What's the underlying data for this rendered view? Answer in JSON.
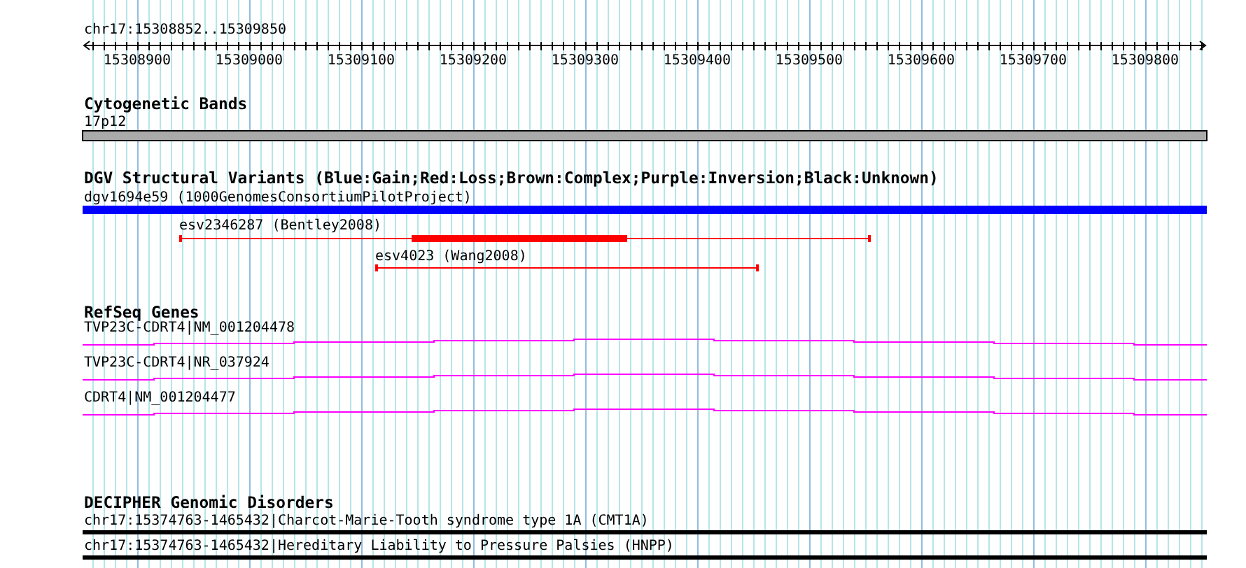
{
  "ruler": {
    "label": "chr17:15308852..15309850",
    "ticks": [
      "15308900",
      "15309000",
      "15309100",
      "15309200",
      "15309300",
      "15309400",
      "15309500",
      "15309600",
      "15309700",
      "15309800"
    ]
  },
  "tracks": [
    {
      "kind": "bands",
      "title": "Cytogenetic Bands",
      "features": [
        {
          "label": "17p12"
        }
      ]
    },
    {
      "kind": "variants",
      "title": "DGV Structural Variants (Blue:Gain;Red:Loss;Brown:Complex;Purple:Inversion;Black:Unknown)",
      "features": [
        {
          "label": "dgv1694e59 (1000GenomesConsortiumPilotProject)",
          "color": "#0000ff"
        },
        {
          "label": "esv2346287 (Bentley2008)",
          "color": "#ff0000"
        },
        {
          "label": "esv4023 (Wang2008)",
          "color": "#ff0000"
        }
      ]
    },
    {
      "kind": "genes",
      "title": "RefSeq Genes",
      "features": [
        {
          "label": "TVP23C-CDRT4|NM_001204478"
        },
        {
          "label": "TVP23C-CDRT4|NR_037924"
        },
        {
          "label": "CDRT4|NM_001204477"
        }
      ]
    },
    {
      "kind": "disorders",
      "title": "DECIPHER Genomic Disorders",
      "features": [
        {
          "label": "chr17:15374763-1465432|Charcot-Marie-Tooth syndrome type 1A (CMT1A)"
        },
        {
          "label": "chr17:15374763-1465432|Hereditary Liability to Pressure Palsies (HNPP)"
        }
      ]
    }
  ]
}
